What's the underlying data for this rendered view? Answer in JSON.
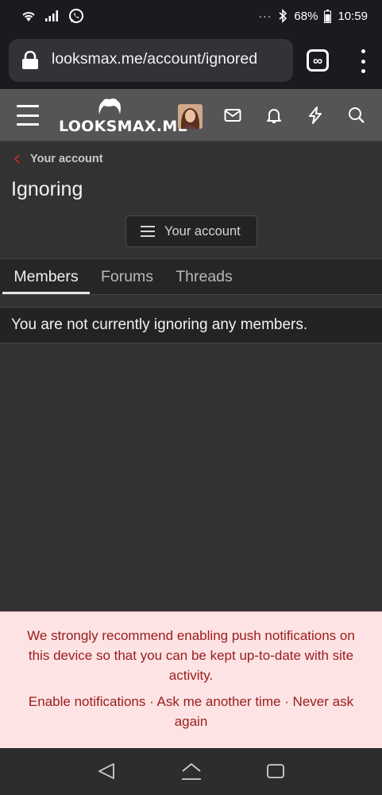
{
  "status_bar": {
    "battery": "68%",
    "time": "10:59",
    "overflow": "···"
  },
  "browser": {
    "url": "looksmax.me/account/ignored",
    "tab_icon": "∞"
  },
  "site_header": {
    "logo_text": "LOOKSMAX.ME"
  },
  "content": {
    "breadcrumb": "Your account",
    "title": "Ignoring",
    "account_button": "Your account",
    "tabs": [
      {
        "label": "Members"
      },
      {
        "label": "Forums"
      },
      {
        "label": "Threads"
      }
    ],
    "empty_notice": "You are not currently ignoring any members."
  },
  "push_notice": {
    "message": "We strongly recommend enabling push notifications on this device so that you can be kept up-to-date with site activity.",
    "enable": "Enable notifications",
    "ask_later": "Ask me another time",
    "never": "Never ask again",
    "separator": " · "
  },
  "colors": {
    "background": "#323232",
    "header": "#555555",
    "accent_red": "#9b1b1b",
    "push_bg": "#fde3e4"
  }
}
